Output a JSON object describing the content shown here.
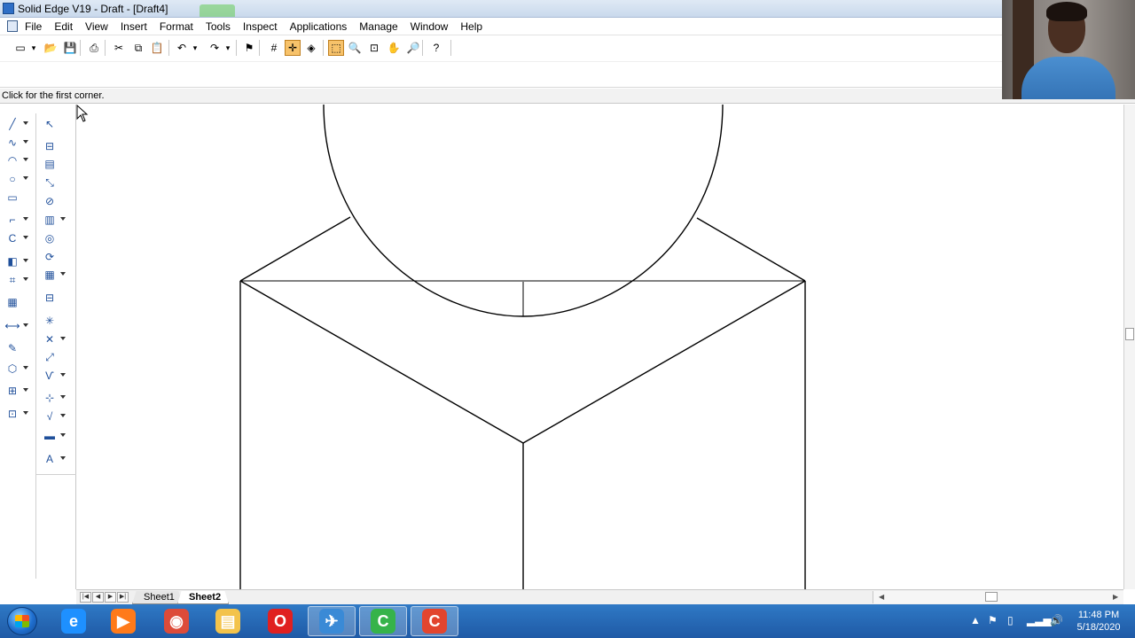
{
  "window": {
    "title": "Solid Edge V19 - Draft - [Draft4]"
  },
  "menu": [
    "File",
    "Edit",
    "View",
    "Insert",
    "Format",
    "Tools",
    "Inspect",
    "Applications",
    "Manage",
    "Window",
    "Help"
  ],
  "toolbar": {
    "buttons": [
      {
        "icon": "new-icon",
        "glyph": "▭"
      },
      {
        "icon": "new-dropdown-icon",
        "glyph": "▾"
      },
      {
        "icon": "open-icon",
        "glyph": "📂"
      },
      {
        "icon": "save-icon",
        "glyph": "💾"
      },
      {
        "icon": "print-icon",
        "glyph": "⎙"
      },
      {
        "icon": "cut-icon",
        "glyph": "✂"
      },
      {
        "icon": "copy-icon",
        "glyph": "⧉"
      },
      {
        "icon": "paste-icon",
        "glyph": "📋"
      },
      {
        "icon": "undo-icon",
        "glyph": "↶"
      },
      {
        "icon": "undo-dropdown-icon",
        "glyph": "▾"
      },
      {
        "icon": "redo-icon",
        "glyph": "↷"
      },
      {
        "icon": "redo-dropdown-icon",
        "glyph": "▾"
      },
      {
        "icon": "flag-icon",
        "glyph": "⚑"
      },
      {
        "icon": "grid-icon",
        "glyph": "#"
      },
      {
        "icon": "snap-icon",
        "glyph": "✛"
      },
      {
        "icon": "layers-icon",
        "glyph": "◈"
      },
      {
        "icon": "zoom-area-icon",
        "glyph": "⬚"
      },
      {
        "icon": "zoom-icon",
        "glyph": "🔍"
      },
      {
        "icon": "fit-icon",
        "glyph": "⊡"
      },
      {
        "icon": "pan-icon",
        "glyph": "✋"
      },
      {
        "icon": "zoom-tool-icon",
        "glyph": "🔎"
      },
      {
        "icon": "help-icon",
        "glyph": "?"
      }
    ]
  },
  "prompt": "Click for the first corner.",
  "palette_left": [
    {
      "icon": "line-icon",
      "glyph": "╱"
    },
    {
      "icon": "curve-icon",
      "glyph": "∿"
    },
    {
      "icon": "arc-icon",
      "glyph": "◠"
    },
    {
      "icon": "circle-icon",
      "glyph": "○"
    },
    {
      "icon": "rectangle-icon",
      "glyph": "▭"
    },
    {
      "icon": "fillet-icon",
      "glyph": "⌐"
    },
    {
      "icon": "trim-icon",
      "glyph": "C"
    },
    {
      "icon": "fill-icon",
      "glyph": "◧"
    },
    {
      "icon": "symbol-icon",
      "glyph": "⌗"
    },
    {
      "icon": "hatch-icon",
      "glyph": "▦"
    },
    {
      "icon": "dimension-icon",
      "glyph": "⟷"
    },
    {
      "icon": "properties-icon",
      "glyph": "✎"
    },
    {
      "icon": "part-icon",
      "glyph": "⬡"
    },
    {
      "icon": "block-icon",
      "glyph": "⊞"
    },
    {
      "icon": "frame-icon",
      "glyph": "⊡"
    }
  ],
  "palette_right": [
    {
      "icon": "select-icon",
      "glyph": "↖"
    },
    {
      "icon": "view-wizard-icon",
      "glyph": "⊟"
    },
    {
      "icon": "principal-view-icon",
      "glyph": "▤"
    },
    {
      "icon": "auxiliary-view-icon",
      "glyph": "⤡"
    },
    {
      "icon": "section-icon",
      "glyph": "⊘"
    },
    {
      "icon": "detail-view-icon",
      "glyph": "▥"
    },
    {
      "icon": "broken-view-icon",
      "glyph": "◎"
    },
    {
      "icon": "rotate-view-icon",
      "glyph": "⟳"
    },
    {
      "icon": "table-icon",
      "glyph": "▦"
    },
    {
      "icon": "balloon-icon",
      "glyph": "⊟"
    },
    {
      "icon": "annotation-icon",
      "glyph": "✳"
    },
    {
      "icon": "centermark-icon",
      "glyph": "✕"
    },
    {
      "icon": "leader-icon",
      "glyph": "⤢"
    },
    {
      "icon": "weld-icon",
      "glyph": "Ѵ"
    },
    {
      "icon": "datum-icon",
      "glyph": "⊹"
    },
    {
      "icon": "surface-icon",
      "glyph": "√"
    },
    {
      "icon": "callout-icon",
      "glyph": "▬"
    },
    {
      "icon": "text-icon",
      "glyph": "A"
    }
  ],
  "sheets": [
    "Sheet1",
    "Sheet2"
  ],
  "active_sheet": "Sheet2",
  "colors": {
    "accent": "#f7c26a",
    "taskbar": "#1f5aa6",
    "drawing_line": "#000000"
  },
  "taskbar": {
    "apps": [
      {
        "icon": "internet-explorer-icon",
        "glyph": "e",
        "color": "#1e90ff"
      },
      {
        "icon": "media-player-icon",
        "glyph": "▶",
        "color": "#ff7a1a"
      },
      {
        "icon": "chrome-icon",
        "glyph": "◉",
        "color": "#dd4b39"
      },
      {
        "icon": "file-explorer-icon",
        "glyph": "▤",
        "color": "#f3c34b"
      },
      {
        "icon": "opera-icon",
        "glyph": "O",
        "color": "#e02020"
      },
      {
        "icon": "solid-edge-icon",
        "glyph": "✈",
        "color": "#3a8ad6"
      },
      {
        "icon": "camtasia-green-icon",
        "glyph": "C",
        "color": "#36b34a"
      },
      {
        "icon": "camtasia-red-icon",
        "glyph": "C",
        "color": "#e2452e"
      }
    ],
    "time": "11:48 PM",
    "date": "5/18/2020"
  }
}
